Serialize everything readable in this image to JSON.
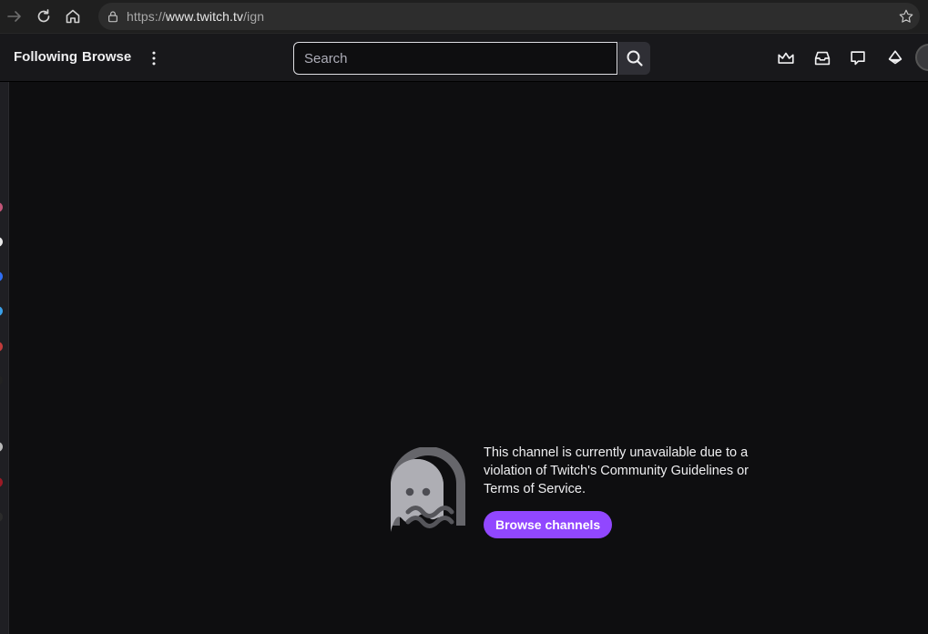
{
  "browser": {
    "url_scheme": "https://",
    "url_host": "www.twitch.tv",
    "url_path": "/ign"
  },
  "topnav": {
    "following_label": "Following",
    "browse_label": "Browse",
    "search_placeholder": "Search",
    "search_value": "",
    "icons": [
      "crown-icon",
      "inbox-icon",
      "whispers-icon",
      "bits-icon"
    ]
  },
  "main": {
    "unavailable_message": "This channel is currently unavailable due to a violation of Twitch's Community Guidelines or Terms of Service.",
    "browse_channels_label": "Browse channels"
  },
  "colors": {
    "accent": "#9147ff",
    "background": "#0e0e10",
    "nav": "#18181b"
  }
}
